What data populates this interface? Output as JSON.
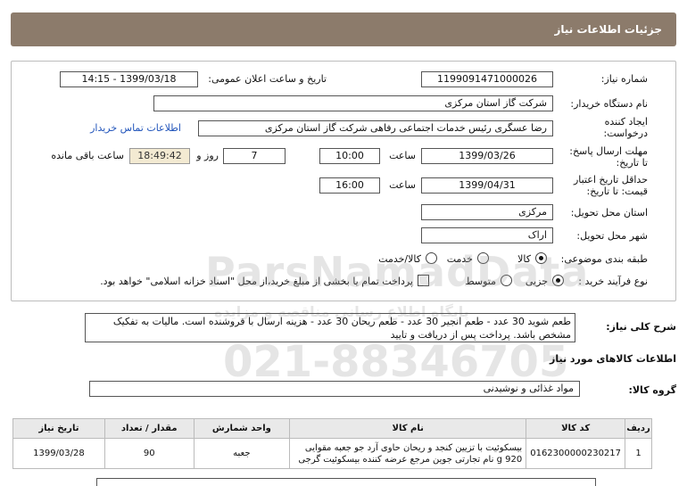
{
  "header": {
    "title": "جزئیات اطلاعات نیاز"
  },
  "watermark": {
    "line1": "ParsNamadData",
    "line2": "پایگاه اطلاع رسانی مناقصه و مزایده",
    "line3": "021-88346705"
  },
  "form": {
    "need_number_label": "شماره نیاز:",
    "need_number_value": "1199091471000026",
    "announce_label": "تاریخ و ساعت اعلان عمومی:",
    "announce_value": "1399/03/18 - 14:15",
    "buyer_label": "نام دستگاه خریدار:",
    "buyer_value": "شرکت گاز استان مرکزی",
    "creator_label_1": "ایجاد کننده",
    "creator_label_2": "درخواست:",
    "creator_value": "رضا عسگری رئیس خدمات اجتماعی رفاهی شرکت گاز استان مرکزی",
    "contact_link": "اطلاعات تماس خریدار",
    "send_deadline_label_1": "مهلت ارسال پاسخ:",
    "send_deadline_label_2": "تا تاریخ:",
    "send_date": "1399/03/26",
    "time_label": "ساعت",
    "send_time": "10:00",
    "days_value": "7",
    "days_label": "روز و",
    "remain_value": "18:49:42",
    "remain_label": "ساعت باقی مانده",
    "validity_label_1": "حداقل تاریخ اعتبار",
    "validity_label_2": "قیمت: تا تاریخ:",
    "validity_date": "1399/04/31",
    "validity_time": "16:00",
    "province_label": "استان محل تحویل:",
    "province_value": "مرکزی",
    "city_label": "شهر محل تحویل:",
    "city_value": "اراک",
    "category_label": "طبقه بندی موضوعی:",
    "category_options": [
      "کالا",
      "خدمت",
      "کالا/خدمت"
    ],
    "process_label": "نوع فرآیند خرید :",
    "process_options": [
      "جزیی",
      "متوسط"
    ],
    "payment_note": "پرداخت تمام یا بخشی از مبلغ خرید،از محل \"اسناد خزانه اسلامی\" خواهد بود."
  },
  "description": {
    "label": "شرح کلی نیاز:",
    "text": "طعم شوید 30 عدد - طعم انجیر 30 عدد - طعم ریحان 30 عدد - هزینه ارسال با فروشنده است. مالیات به تفکیک مشخص باشد. پرداخت پس از دریافت و تایید"
  },
  "goods_section": {
    "title": "اطلاعات کالاهای مورد نیاز",
    "group_label": "گروه کالا:",
    "group_value": "مواد غذائی و نوشیدنی"
  },
  "table": {
    "headers": [
      "ردیف",
      "کد کالا",
      "نام کالا",
      "واحد شمارش",
      "مقدار / تعداد",
      "تاریخ نیاز"
    ],
    "rows": [
      [
        "1",
        "0162300000230217",
        "بیسکوئیت با تزیین کنجد و ریحان حاوی آرد جو جعبه مقوایی 920 g نام تجارتی جوین مرجع عرضه کننده بیسکوئیت گرجی",
        "جعبه",
        "90",
        "1399/03/28"
      ]
    ]
  }
}
